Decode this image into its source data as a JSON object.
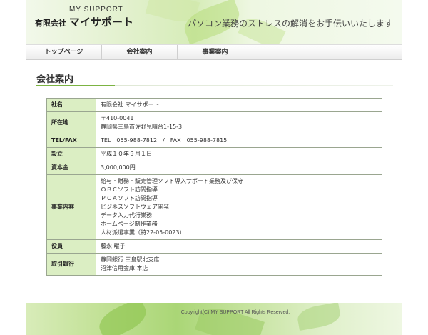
{
  "header": {
    "logo_en": "MY SUPPORT",
    "logo_prefix": "有限会社",
    "logo_name": "マイサポート",
    "tagline": "パソコン業務のストレスの解消をお手伝いいたします"
  },
  "nav": {
    "items": [
      {
        "label": "トップページ"
      },
      {
        "label": "会社案内"
      },
      {
        "label": "事業案内"
      }
    ]
  },
  "section": {
    "title": "会社案内"
  },
  "company": {
    "rows": [
      {
        "label": "社名",
        "lines": [
          "有限会社 マイサポート"
        ]
      },
      {
        "label": "所在地",
        "lines": [
          "〒410-0041",
          "静岡県三島市佐野見晴台1-15-3"
        ]
      },
      {
        "label": "TEL/FAX",
        "lines": [
          "TEL　055-988-7812　/　FAX　055-988-7815"
        ]
      },
      {
        "label": "設立",
        "lines": [
          "平成１０年９月１日"
        ]
      },
      {
        "label": "資本金",
        "lines": [
          "3,000,000円"
        ]
      },
      {
        "label": "事業内容",
        "lines": [
          "給与・財務・販売管理ソフト導入サポート業務及び保守",
          "ＯＢＣソフト訪問指導",
          "ＰＣＡソフト訪問指導",
          "ビジネスソフトウェア開発",
          "データ入力代行業務",
          "ホームページ制作業務",
          "人材派遣事業（特22-05-0023）"
        ]
      },
      {
        "label": "役員",
        "lines": [
          "藤永 曜子"
        ]
      },
      {
        "label": "取引銀行",
        "lines": [
          "静岡銀行 三島駅北支店",
          "沼津信用金庫 本店"
        ]
      }
    ]
  },
  "footer": {
    "copyright": "Copyright(C) MY SUPPORT All Rights Reserved."
  }
}
